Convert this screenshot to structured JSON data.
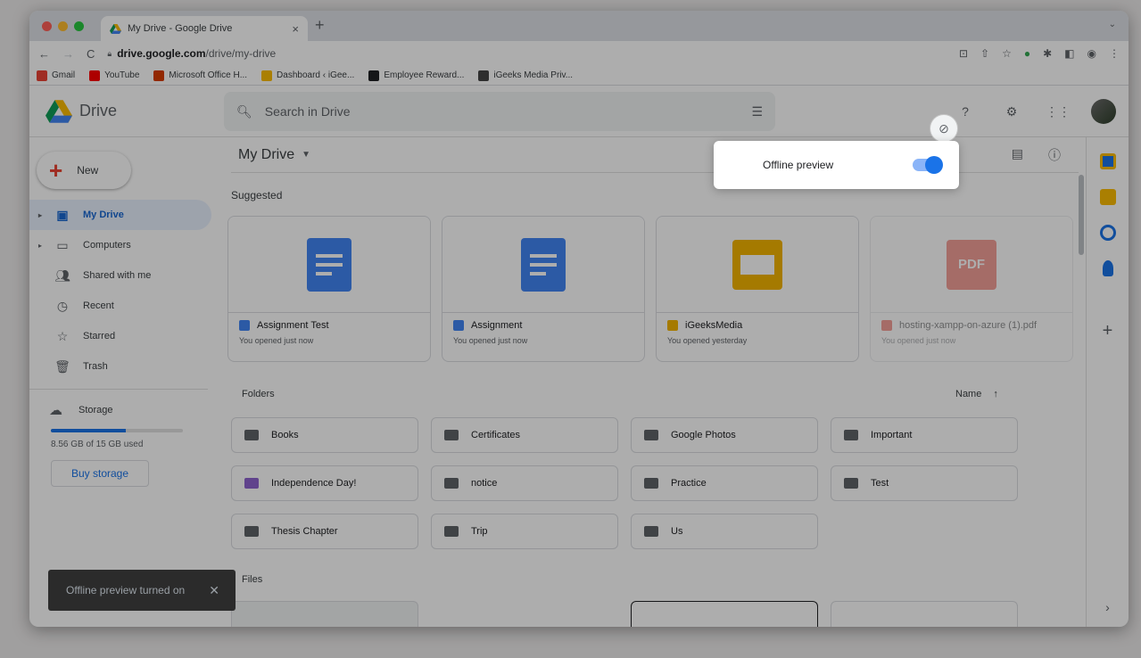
{
  "browser": {
    "tab_title": "My Drive - Google Drive",
    "tab_close": "×",
    "new_tab": "+",
    "url_host": "drive.google.com",
    "url_path": "/drive/my-drive",
    "bookmarks": [
      {
        "label": "Gmail",
        "color": "#ea4335"
      },
      {
        "label": "YouTube",
        "color": "#ff0000"
      },
      {
        "label": "Microsoft Office H...",
        "color": "#d83b01"
      },
      {
        "label": "Dashboard ‹ iGee...",
        "color": "#fbbc04"
      },
      {
        "label": "Employee Reward...",
        "color": "#202124"
      },
      {
        "label": "iGeeks Media Priv...",
        "color": "#444444"
      }
    ]
  },
  "drive": {
    "logo_text": "Drive",
    "search_placeholder": "Search in Drive",
    "new_label": "New",
    "nav": [
      {
        "label": "My Drive",
        "icon": "my-drive-icon"
      },
      {
        "label": "Computers",
        "icon": "computers-icon"
      },
      {
        "label": "Shared with me",
        "icon": "shared-icon"
      },
      {
        "label": "Recent",
        "icon": "clock-icon"
      },
      {
        "label": "Starred",
        "icon": "star-icon"
      },
      {
        "label": "Trash",
        "icon": "trash-icon"
      }
    ],
    "storage_label": "Storage",
    "storage_used": "8.56 GB of 15 GB used",
    "storage_fraction": 0.57,
    "buy_storage": "Buy storage",
    "header_title": "My Drive",
    "suggested_label": "Suggested",
    "suggested": [
      {
        "name": "Assignment Test",
        "sub": "You opened just now",
        "type": "doc"
      },
      {
        "name": "Assignment",
        "sub": "You opened just now",
        "type": "doc"
      },
      {
        "name": "iGeeksMedia",
        "sub": "You opened yesterday",
        "type": "slides"
      },
      {
        "name": "hosting-xampp-on-azure (1).pdf",
        "sub": "You opened just now",
        "type": "pdf"
      }
    ],
    "pdf_badge": "PDF",
    "folders_label": "Folders",
    "sort_label": "Name",
    "sort_arrow": "↑",
    "folders": [
      {
        "name": "Books",
        "kind": "plain"
      },
      {
        "name": "Certificates",
        "kind": "plain"
      },
      {
        "name": "Google Photos",
        "kind": "plain"
      },
      {
        "name": "Important",
        "kind": "plain"
      },
      {
        "name": "Independence Day!",
        "kind": "shared-purple"
      },
      {
        "name": "notice",
        "kind": "shared"
      },
      {
        "name": "Practice",
        "kind": "plain"
      },
      {
        "name": "Test",
        "kind": "plain"
      },
      {
        "name": "Thesis Chapter",
        "kind": "shared"
      },
      {
        "name": "Trip",
        "kind": "plain"
      },
      {
        "name": "Us",
        "kind": "plain"
      }
    ],
    "files_label": "Files"
  },
  "popup": {
    "label": "Offline preview",
    "enabled": true
  },
  "toast": {
    "message": "Offline preview turned on",
    "close": "✕"
  },
  "colors": {
    "accent": "#1a73e8",
    "doc_blue": "#4285f4",
    "slides_yellow": "#f4b400",
    "pdf_red": "#ea4335"
  }
}
